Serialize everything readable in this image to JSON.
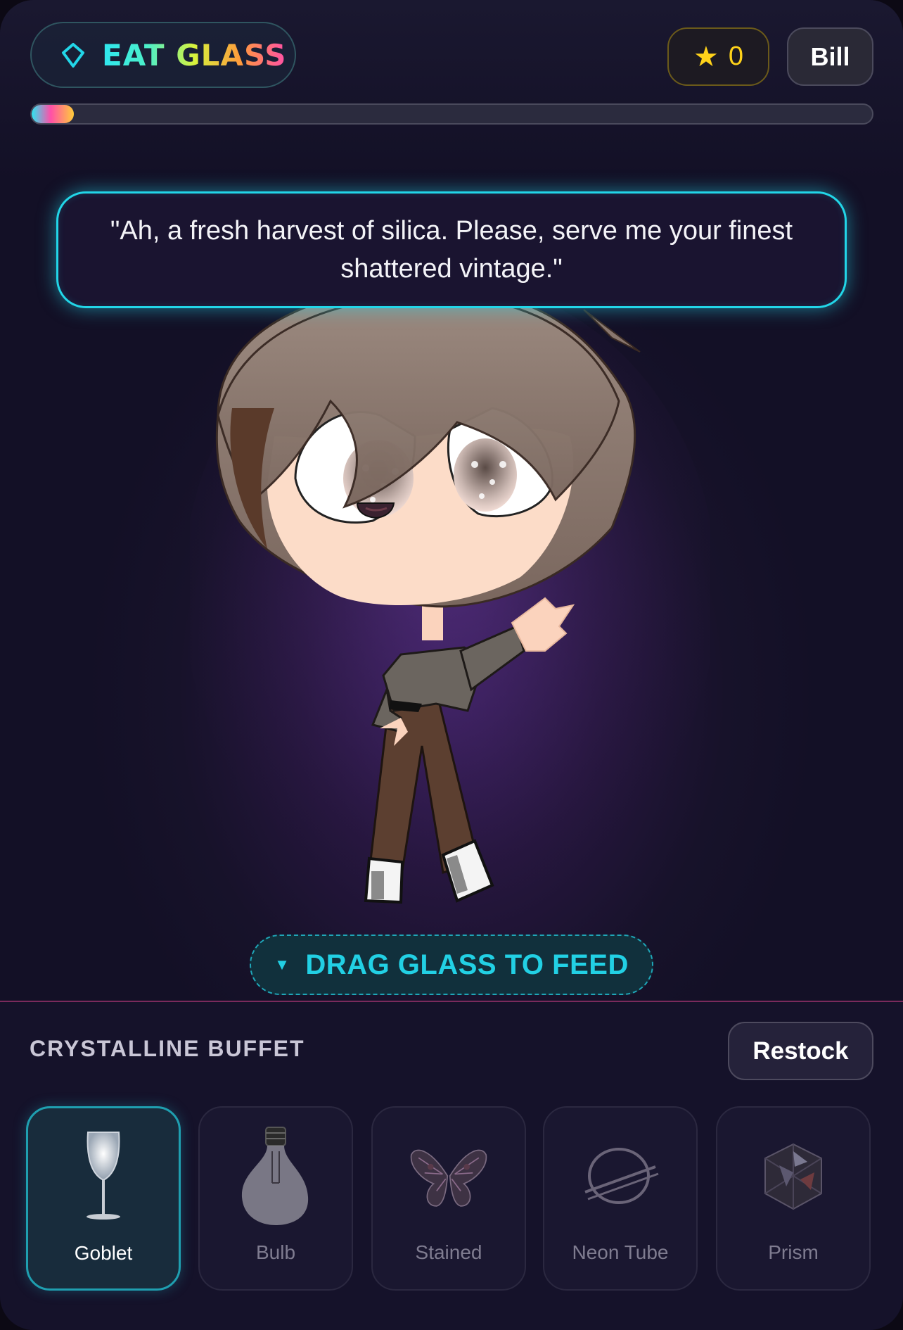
{
  "header": {
    "logo_text": "EAT GLASS",
    "score": "0",
    "user_name": "Bill",
    "progress_percent": 5
  },
  "speech": {
    "text": "\"Ah, a fresh harvest of silica. Please, serve me your finest shattered vintage.\""
  },
  "drag_hint": {
    "text": "DRAG GLASS TO FEED"
  },
  "buffet": {
    "title": "CRYSTALLINE BUFFET",
    "restock_label": "Restock",
    "items": [
      {
        "label": "Goblet",
        "icon": "goblet-icon",
        "selected": true
      },
      {
        "label": "Bulb",
        "icon": "bulb-icon",
        "selected": false
      },
      {
        "label": "Stained",
        "icon": "stained-glass-icon",
        "selected": false
      },
      {
        "label": "Neon Tube",
        "icon": "neon-tube-icon",
        "selected": false
      },
      {
        "label": "Prism",
        "icon": "prism-icon",
        "selected": false
      }
    ]
  },
  "colors": {
    "accent_cyan": "#22d6e8",
    "score_gold": "#ffd21a",
    "divider_magenta": "#7a2a5c"
  }
}
